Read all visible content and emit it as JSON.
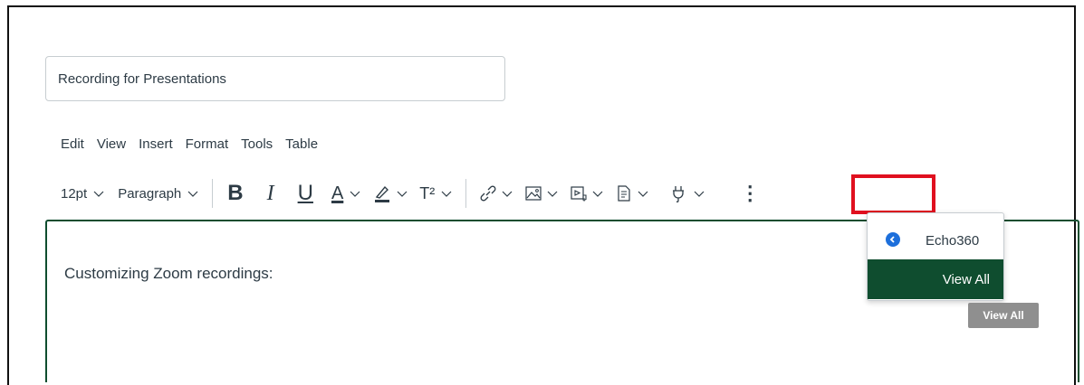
{
  "title_input": {
    "value": "Recording for Presentations"
  },
  "menubar": [
    "Edit",
    "View",
    "Insert",
    "Format",
    "Tools",
    "Table"
  ],
  "toolbar": {
    "font_size": "12pt",
    "block_format": "Paragraph",
    "bold": "B",
    "italic": "I",
    "underline": "U",
    "text_color": "A",
    "superscript": "T²",
    "more": "⋮"
  },
  "editor": {
    "content": "Customizing Zoom recordings:"
  },
  "plugins_menu": {
    "items": [
      {
        "label": "Echo360",
        "icon": "echo360-icon"
      },
      {
        "label": "View All"
      }
    ],
    "tooltip": "View All"
  },
  "colors": {
    "accent_green": "#0f4d2f",
    "highlight_red": "#e0101f",
    "echo_blue": "#1d6fdb"
  }
}
